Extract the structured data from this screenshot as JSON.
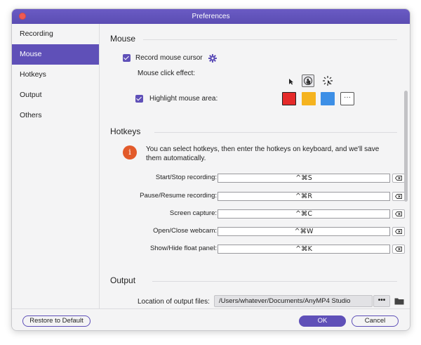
{
  "window": {
    "title": "Preferences"
  },
  "sidebar": {
    "items": [
      {
        "label": "Recording",
        "active": false
      },
      {
        "label": "Mouse",
        "active": true
      },
      {
        "label": "Hotkeys",
        "active": false
      },
      {
        "label": "Output",
        "active": false
      },
      {
        "label": "Others",
        "active": false
      }
    ]
  },
  "mouse": {
    "heading": "Mouse",
    "record_cursor_label": "Record mouse cursor",
    "record_cursor_checked": true,
    "click_effect_label": "Mouse click effect:",
    "click_effects": [
      "arrow-cursor-icon",
      "hand-click-icon",
      "click-burst-icon"
    ],
    "selected_click_effect": "hand-click-icon",
    "highlight_label": "Highlight mouse area:",
    "highlight_checked": true,
    "highlight_colors": [
      "#e52a2a",
      "#f5b31f",
      "#3d8fe6"
    ],
    "more_label": "···"
  },
  "hotkeys": {
    "heading": "Hotkeys",
    "info_icon": "i",
    "info_text": "You can select hotkeys, then enter the hotkeys on keyboard, and we'll save them automatically.",
    "rows": [
      {
        "label": "Start/Stop recording:",
        "value": "^⌘S"
      },
      {
        "label": "Pause/Resume recording:",
        "value": "^⌘R"
      },
      {
        "label": "Screen capture:",
        "value": "^⌘C"
      },
      {
        "label": "Open/Close webcam:",
        "value": "^⌘W"
      },
      {
        "label": "Show/Hide float panel:",
        "value": "^⌘K"
      }
    ]
  },
  "output": {
    "heading": "Output",
    "location_label": "Location of output files:",
    "location_value": "/Users/whatever/Documents/AnyMP4 Studio",
    "more_label": "•••"
  },
  "footer": {
    "restore_label": "Restore to Default",
    "ok_label": "OK",
    "cancel_label": "Cancel"
  },
  "colors": {
    "accent": "#5f50b8",
    "titlebar": "#5b4db3",
    "info": "#e25a2a"
  }
}
